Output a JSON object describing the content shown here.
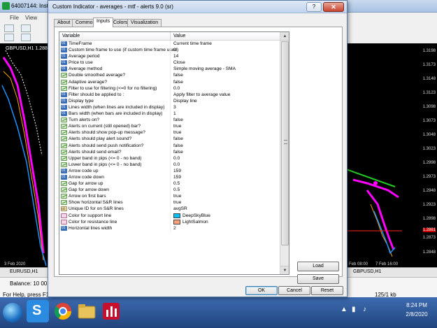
{
  "background": {
    "title": "64007144: Instal",
    "menu": [
      "File",
      "View"
    ],
    "chart_symbol": "GBPUSD,H1  1.288",
    "price_labels": [
      "1.3198",
      "1.3173",
      "1.3148",
      "1.3123",
      "1.3098",
      "1.3073",
      "1.3048",
      "1.3023",
      "1.2998",
      "1.2973",
      "1.2948",
      "1.2923",
      "1.2898",
      "1.2881",
      "1.2873",
      "1.2848"
    ],
    "left_date": "3 Feb 2020",
    "right_dates": [
      "Feb 08:00",
      "7 Feb 16:00"
    ],
    "bottom_tabs": [
      "EURUSD,H1",
      "GBPUSD,H1"
    ],
    "balance": "Balance: 10 00",
    "status": "For Help, press F1",
    "kb": "125/1 kb"
  },
  "taskbar": {
    "time": "8:24 PM",
    "date": "2/8/2020",
    "skype_letter": "S"
  },
  "dialog": {
    "title": "Custom Indicator - averages - mtf - alerts 9.0 (sr)",
    "help_label": "?",
    "close_label": "✕",
    "tabs": [
      "About",
      "Common",
      "Inputs",
      "Colors",
      "Visualization"
    ],
    "active_tab": "Inputs",
    "columns": {
      "variable": "Variable",
      "value": "Value"
    },
    "params": [
      {
        "icon": "num",
        "name": "TimeFrame",
        "value": "Current time frame"
      },
      {
        "icon": "num",
        "name": "Custom time frame to use (if custom time frame used)",
        "value": "0"
      },
      {
        "icon": "num",
        "name": "Average period",
        "value": "14"
      },
      {
        "icon": "num",
        "name": "Price to use",
        "value": "Close"
      },
      {
        "icon": "num",
        "name": "Average method",
        "value": "Simple moving average - SMA"
      },
      {
        "icon": "bool",
        "name": "Double smoothed average?",
        "value": "false"
      },
      {
        "icon": "bool",
        "name": "Adaptive average?",
        "value": "false"
      },
      {
        "icon": "bool",
        "name": "Filter to use for filtering (<=0 for no filtering)",
        "value": "0.0"
      },
      {
        "icon": "num",
        "name": "Filter should be applied to :",
        "value": "Apply filter to average value"
      },
      {
        "icon": "num",
        "name": "Display type",
        "value": "Display line"
      },
      {
        "icon": "num",
        "name": "Lines width (when lines are included in display)",
        "value": "3"
      },
      {
        "icon": "num",
        "name": "Bars width (when bars are included in display)",
        "value": "1"
      },
      {
        "icon": "bool",
        "name": "Turn alerts on?",
        "value": "false"
      },
      {
        "icon": "bool",
        "name": "Alerts on current (still opened) bar?",
        "value": "true"
      },
      {
        "icon": "bool",
        "name": "Alerts should show pop-up message?",
        "value": "true"
      },
      {
        "icon": "bool",
        "name": "Alerts should play alert sound?",
        "value": "false"
      },
      {
        "icon": "bool",
        "name": "Alerts should send push notification?",
        "value": "false"
      },
      {
        "icon": "bool",
        "name": "Alerts should send email?",
        "value": "false"
      },
      {
        "icon": "bool",
        "name": "Upper band in pips (<= 0 - no band)",
        "value": "0.0"
      },
      {
        "icon": "bool",
        "name": "Lower band in pips (<= 0 - no band)",
        "value": "0.0"
      },
      {
        "icon": "num",
        "name": "Arrow code up",
        "value": "159"
      },
      {
        "icon": "num",
        "name": "Arrow code down",
        "value": "159"
      },
      {
        "icon": "bool",
        "name": "Gap for arrow up",
        "value": "0.5"
      },
      {
        "icon": "bool",
        "name": "Gap for arrow down",
        "value": "0.5"
      },
      {
        "icon": "bool",
        "name": "Arrow on first bars",
        "value": "true"
      },
      {
        "icon": "bool",
        "name": "Show horizontal S&R lines",
        "value": "true"
      },
      {
        "icon": "str",
        "name": "Unique ID for on S&R lines",
        "value": "avgSR"
      },
      {
        "icon": "color",
        "name": "Color for support line",
        "value": "DeepSkyBlue",
        "swatch": "#00bfff"
      },
      {
        "icon": "color",
        "name": "Color for resistance line",
        "value": "LightSalmon",
        "swatch": "#ffa07a"
      },
      {
        "icon": "num",
        "name": "Horizontal lines width",
        "value": "2"
      }
    ],
    "buttons": {
      "load": "Load",
      "save": "Save",
      "ok": "OK",
      "cancel": "Cancel",
      "reset": "Reset"
    }
  },
  "colors": {
    "dialog_border": "#5b7aa7",
    "chart_bg": "#000000"
  }
}
